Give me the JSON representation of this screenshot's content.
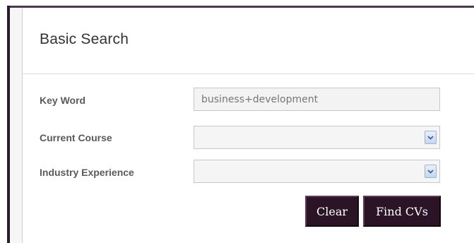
{
  "form": {
    "title": "Basic Search",
    "keyword": {
      "label": "Key Word",
      "value": "business+development"
    },
    "current_course": {
      "label": "Current Course",
      "selected": ""
    },
    "industry_experience": {
      "label": "Industry Experience",
      "selected": ""
    },
    "buttons": {
      "clear": "Clear",
      "find": "Find CVs"
    }
  },
  "colors": {
    "button_bg": "#2a1426",
    "frame_border": "#2b1b2f",
    "label_text": "#5a5a5a"
  },
  "icons": {
    "dropdown": "chevron-down-icon"
  }
}
